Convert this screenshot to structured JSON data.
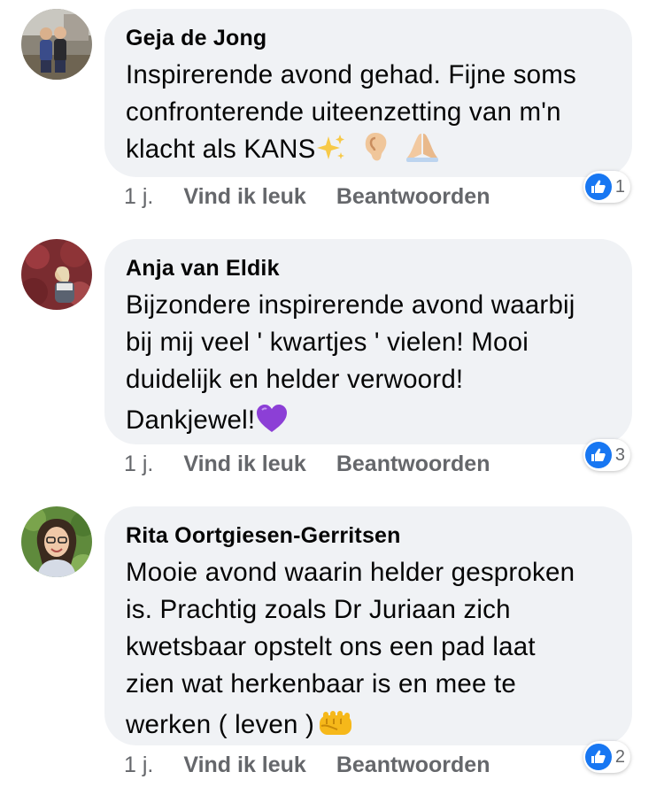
{
  "colors": {
    "bubble": "#f0f2f5",
    "meta_text": "#65676b",
    "like_blue": "#1877f2"
  },
  "comments": [
    {
      "author": "Geja de Jong",
      "lines": [
        "Inspirerende avond gehad. Fijne soms",
        "confronterende uiteenzetting van m'n",
        "klacht als KANS"
      ],
      "emojis": [
        "sparkles-emoji",
        "ear-emoji",
        "folded-hands-emoji"
      ],
      "time": "1 j.",
      "like_label": "Vind ik leuk",
      "reply_label": "Beantwoorden",
      "reaction_icon": "like-icon",
      "reaction_count": "1"
    },
    {
      "author": "Anja van Eldik",
      "lines": [
        "Bijzondere inspirerende avond waarbij",
        "bij mij veel ' kwartjes ' vielen!  Mooi",
        "duidelijk en helder verwoord!",
        "Dankjewel!"
      ],
      "emojis": [
        "purple-heart-emoji"
      ],
      "time": "1 j.",
      "like_label": "Vind ik leuk",
      "reply_label": "Beantwoorden",
      "reaction_icon": "like-icon",
      "reaction_count": "3"
    },
    {
      "author": "Rita Oortgiesen-Gerritsen",
      "lines": [
        "Mooie avond waarin helder gesproken",
        "is. Prachtig zoals Dr Juriaan zich",
        "kwetsbaar opstelt ons een pad laat",
        "zien wat herkenbaar is en mee te",
        "werken ( leven )"
      ],
      "emojis": [
        "fist-emoji"
      ],
      "time": "1 j.",
      "like_label": "Vind ik leuk",
      "reply_label": "Beantwoorden",
      "reaction_icon": "like-icon",
      "reaction_count": "2"
    }
  ]
}
